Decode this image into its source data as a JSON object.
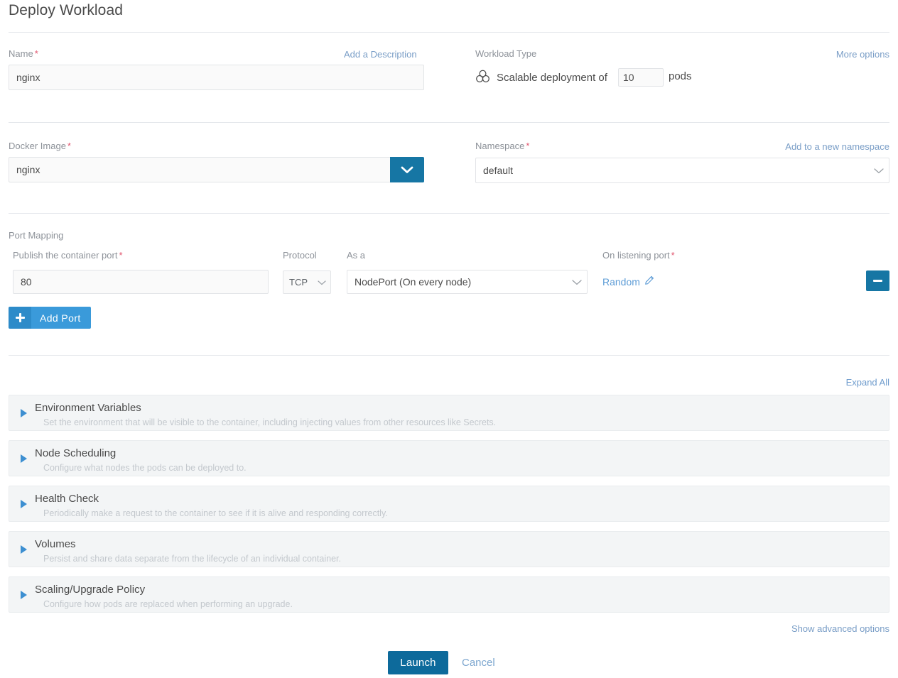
{
  "page": {
    "title": "Deploy Workload"
  },
  "name_section": {
    "label": "Name",
    "required_marker": "*",
    "add_description_link": "Add a Description",
    "value": "nginx",
    "placeholder": ""
  },
  "workload_type": {
    "label": "Workload Type",
    "more_options_link": "More options",
    "icon": "scalable-deployment-icon",
    "prefix_text": "Scalable deployment of",
    "pods_count": "10",
    "suffix_text": "pods"
  },
  "docker_image": {
    "label": "Docker Image",
    "required_marker": "*",
    "value": "nginx",
    "dropdown_icon": "chevron-down-icon"
  },
  "namespace": {
    "label": "Namespace",
    "required_marker": "*",
    "add_link": "Add to a new namespace",
    "value": "default",
    "dropdown_icon": "chevron-down-icon"
  },
  "port_mapping": {
    "section_label": "Port Mapping",
    "publish_label": "Publish the container port",
    "publish_required": "*",
    "publish_value": "80",
    "protocol_label": "Protocol",
    "protocol_value": "TCP",
    "as_a_label": "As a",
    "as_a_value": "NodePort (On every node)",
    "listening_label": "On listening port",
    "listening_required": "*",
    "listening_value": "Random",
    "edit_icon": "pencil-icon",
    "remove_icon": "minus-icon",
    "add_port_label": "Add Port",
    "add_port_icon": "plus-icon"
  },
  "expand_all_link": "Expand All",
  "accordions": [
    {
      "title": "Environment Variables",
      "description": "Set the environment that will be visible to the container, including injecting values from other resources like Secrets.",
      "arrow_icon": "triangle-right-icon"
    },
    {
      "title": "Node Scheduling",
      "description": "Configure what nodes the pods can be deployed to.",
      "arrow_icon": "triangle-right-icon"
    },
    {
      "title": "Health Check",
      "description": "Periodically make a request to the container to see if it is alive and responding correctly.",
      "arrow_icon": "triangle-right-icon"
    },
    {
      "title": "Volumes",
      "description": "Persist and share data separate from the lifecycle of an individual container.",
      "arrow_icon": "triangle-right-icon"
    },
    {
      "title": "Scaling/Upgrade Policy",
      "description": "Configure how pods are replaced when performing an upgrade.",
      "arrow_icon": "triangle-right-icon"
    }
  ],
  "show_advanced_link": "Show advanced options",
  "footer": {
    "launch_label": "Launch",
    "cancel_label": "Cancel"
  },
  "colors": {
    "primary_blue": "#1676a4",
    "launch_blue": "#0d6a9b",
    "add_port_blue": "#3a9ada",
    "link_blue": "#7a9ec7",
    "required_red": "#e1566f",
    "accordion_bg": "#f3f5f6",
    "arrow_blue": "#3d8fd1"
  }
}
